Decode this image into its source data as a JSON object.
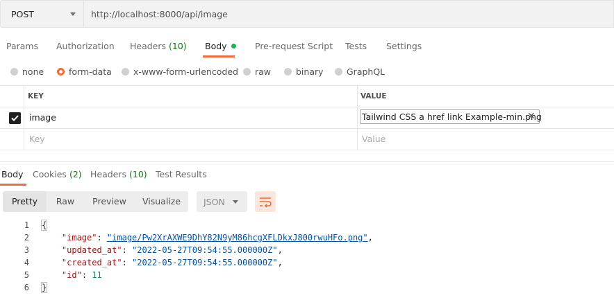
{
  "request": {
    "method": "POST",
    "url": "http://localhost:8000/api/image"
  },
  "request_tabs": [
    {
      "label": "Params"
    },
    {
      "label": "Authorization"
    },
    {
      "label": "Headers",
      "count": "(10)"
    },
    {
      "label": "Body",
      "active": true
    },
    {
      "label": "Pre-request Script"
    },
    {
      "label": "Tests"
    },
    {
      "label": "Settings"
    }
  ],
  "body_types": [
    "none",
    "form-data",
    "x-www-form-urlencoded",
    "raw",
    "binary",
    "GraphQL"
  ],
  "body_type_selected": "form-data",
  "kv_table": {
    "key_header": "KEY",
    "value_header": "VALUE",
    "rows": [
      {
        "checked": true,
        "key": "image",
        "value": "Tailwind CSS a href link Example-min.png"
      }
    ],
    "key_placeholder": "Key",
    "value_placeholder": "Value"
  },
  "response_tabs": [
    {
      "label": "Body",
      "active": true
    },
    {
      "label": "Cookies",
      "count": "(2)"
    },
    {
      "label": "Headers",
      "count": "(10)"
    },
    {
      "label": "Test Results"
    }
  ],
  "view_modes": [
    "Pretty",
    "Raw",
    "Preview",
    "Visualize"
  ],
  "view_mode_selected": "Pretty",
  "format": "JSON",
  "code": {
    "line_numbers": [
      "1",
      "2",
      "3",
      "4",
      "5",
      "6"
    ],
    "open_brace": "{",
    "close_brace": "}",
    "fields": [
      {
        "key": "\"image\"",
        "value": "\"image/Pw2XrAXWE9DhY82N9yM86hcgXFLDkxJ800rwuHFo.png\""
      },
      {
        "key": "\"updated_at\"",
        "value": "\"2022-05-27T09:54:55.000000Z\""
      },
      {
        "key": "\"created_at\"",
        "value": "\"2022-05-27T09:54:55.000000Z\""
      },
      {
        "key": "\"id\"",
        "value": "11"
      }
    ]
  },
  "colors": {
    "accent": "#f26b3a",
    "success_dot": "#0cbb52",
    "count_green": "#0f7b0f"
  }
}
